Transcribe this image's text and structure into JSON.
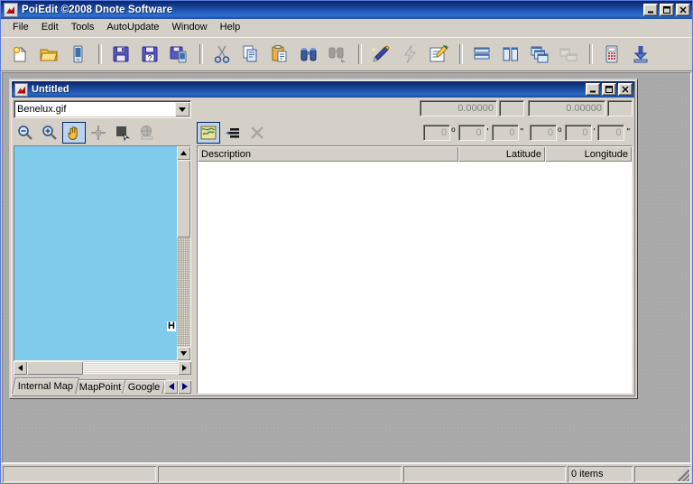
{
  "window": {
    "title": "PoiEdit ©2008 Dnote Software",
    "icon": "app-icon",
    "controls": [
      {
        "name": "minimize-button",
        "label": "_"
      },
      {
        "name": "maximize-button",
        "label": "□"
      },
      {
        "name": "close-button",
        "label": "✕"
      }
    ]
  },
  "menubar": {
    "items": [
      {
        "label": "File"
      },
      {
        "label": "Edit"
      },
      {
        "label": "Tools"
      },
      {
        "label": "AutoUpdate"
      },
      {
        "label": "Window"
      },
      {
        "label": "Help"
      }
    ]
  },
  "toolbar": {
    "groups": [
      {
        "buttons": [
          {
            "name": "new-file-button",
            "icon": "new-document-icon",
            "enabled": true
          },
          {
            "name": "open-file-button",
            "icon": "open-folder-icon",
            "enabled": true
          },
          {
            "name": "read-device-button",
            "icon": "pda-device-icon",
            "enabled": true
          }
        ]
      },
      {
        "buttons": [
          {
            "name": "save-button",
            "icon": "floppy-save-icon",
            "enabled": true
          },
          {
            "name": "save-as-button",
            "icon": "floppy-save-as-icon",
            "enabled": true
          },
          {
            "name": "save-to-device-button",
            "icon": "floppy-to-device-icon",
            "enabled": true
          }
        ]
      },
      {
        "buttons": [
          {
            "name": "cut-button",
            "icon": "scissors-icon",
            "enabled": true
          },
          {
            "name": "copy-button",
            "icon": "copy-pages-icon",
            "enabled": true
          },
          {
            "name": "paste-button",
            "icon": "clipboard-paste-icon",
            "enabled": true
          },
          {
            "name": "find-button",
            "icon": "binoculars-icon",
            "enabled": true
          },
          {
            "name": "find-next-button",
            "icon": "binoculars-next-icon",
            "enabled": false
          }
        ]
      },
      {
        "buttons": [
          {
            "name": "wizard-button",
            "icon": "magic-wand-icon",
            "enabled": true
          },
          {
            "name": "convert-button",
            "icon": "lightning-bolt-icon",
            "enabled": false
          },
          {
            "name": "properties-button",
            "icon": "edit-properties-icon",
            "enabled": true
          }
        ]
      },
      {
        "buttons": [
          {
            "name": "tile-horizontal-button",
            "icon": "tile-horizontal-icon",
            "enabled": true
          },
          {
            "name": "tile-vertical-button",
            "icon": "tile-vertical-icon",
            "enabled": true
          },
          {
            "name": "cascade-windows-button",
            "icon": "cascade-windows-icon",
            "enabled": true
          },
          {
            "name": "arrange-icons-button",
            "icon": "arrange-icons-icon",
            "enabled": false
          }
        ]
      },
      {
        "buttons": [
          {
            "name": "calculator-button",
            "icon": "calculator-icon",
            "enabled": true
          },
          {
            "name": "download-button",
            "icon": "download-arrow-icon",
            "enabled": true
          }
        ]
      }
    ]
  },
  "child_window": {
    "title": "Untitled",
    "icon": "document-icon",
    "controls": [
      {
        "name": "child-minimize-button",
        "label": "_"
      },
      {
        "name": "child-maximize-button",
        "label": "□"
      },
      {
        "name": "child-close-button",
        "label": "✕"
      }
    ],
    "map_select": {
      "value": "Benelux.gif",
      "arrow_icon": "chevron-down-icon"
    },
    "map_tools": [
      {
        "name": "zoom-out-button",
        "icon": "zoom-out-icon",
        "active": false,
        "enabled": true
      },
      {
        "name": "zoom-in-button",
        "icon": "zoom-in-icon",
        "active": false,
        "enabled": true
      },
      {
        "name": "pan-tool-button",
        "icon": "hand-pan-icon",
        "active": true,
        "enabled": true
      },
      {
        "name": "center-crosshair-button",
        "icon": "crosshair-icon",
        "active": false,
        "enabled": true
      },
      {
        "name": "select-area-button",
        "icon": "select-area-icon",
        "active": false,
        "enabled": true
      },
      {
        "name": "web-map-button",
        "icon": "globe-icon",
        "active": false,
        "enabled": false
      }
    ],
    "list_tools": [
      {
        "name": "add-poi-button",
        "icon": "map-add-icon",
        "active": true,
        "enabled": true
      },
      {
        "name": "edit-entry-button",
        "icon": "list-edit-icon",
        "active": false,
        "enabled": true
      },
      {
        "name": "delete-entry-button",
        "icon": "delete-x-icon",
        "active": false,
        "enabled": false
      }
    ],
    "coordinates": {
      "latitude_decimal": "0.00000",
      "longitude_decimal": "0.00000",
      "latitude_dms": {
        "degrees": "0",
        "minutes": "0",
        "seconds": "0"
      },
      "longitude_dms": {
        "degrees": "0",
        "minutes": "0",
        "seconds": "0"
      },
      "units": {
        "degree": "o",
        "minute": "'",
        "second": "\""
      }
    },
    "map": {
      "edge_label": "H",
      "water_color": "#7ecbeb",
      "vertical_scrollbar": {
        "up_icon": "scroll-up-arrow-icon",
        "down_icon": "scroll-down-arrow-icon"
      },
      "horizontal_scrollbar": {
        "left_icon": "scroll-left-arrow-icon",
        "right_icon": "scroll-right-arrow-icon"
      }
    },
    "tabs": [
      {
        "label": "Internal Map",
        "selected": true
      },
      {
        "label": "MapPoint",
        "selected": false
      },
      {
        "label": "Google ",
        "selected": false
      }
    ],
    "tab_spinner": [
      {
        "name": "tab-scroll-left-button",
        "icon": "left-arrow-icon"
      },
      {
        "name": "tab-scroll-right-button",
        "icon": "right-arrow-icon"
      }
    ],
    "list": {
      "columns": [
        {
          "label": "Description",
          "align": "left"
        },
        {
          "label": "Latitude",
          "align": "right"
        },
        {
          "label": "Longitude",
          "align": "right"
        }
      ],
      "rows": []
    }
  },
  "statusbar": {
    "panel1": "",
    "panel2": "",
    "panel3": "",
    "item_count": "0 items",
    "panel5": ""
  }
}
